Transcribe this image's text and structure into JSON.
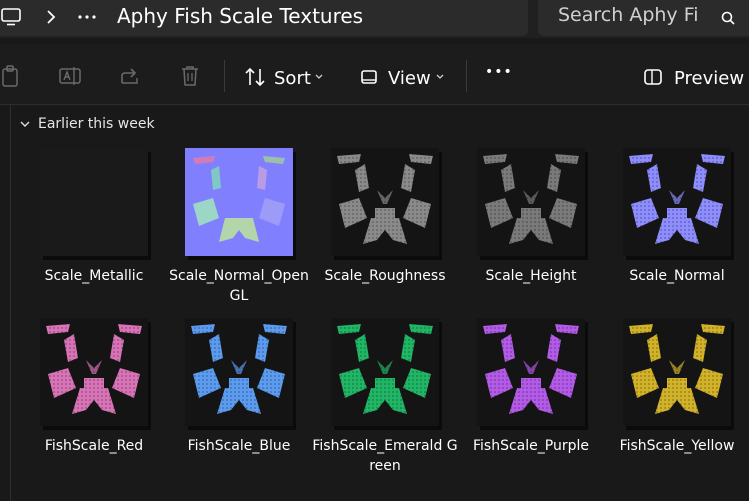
{
  "window": {
    "title": "Aphy Fish Scale Textures",
    "search_placeholder": "Search Aphy Fi"
  },
  "toolbar": {
    "sort_label": "Sort",
    "view_label": "View",
    "more_label": "•••",
    "preview_label": "Preview"
  },
  "group": {
    "label": "Earlier this week"
  },
  "files": [
    {
      "name": "Scale_Metallic",
      "color": "#1a1a1a",
      "style": "dark"
    },
    {
      "name": "Scale_Normal_OpenGL",
      "color": "#8080ff",
      "style": "normalgl"
    },
    {
      "name": "Scale_Roughness",
      "color": "#8a8a8a",
      "style": "mask"
    },
    {
      "name": "Scale_Height",
      "color": "#7a7a7a",
      "style": "mask"
    },
    {
      "name": "Scale_Normal",
      "color": "#8d8dff",
      "style": "mask"
    },
    {
      "name": "FishScale_Red",
      "color": "#d873b8",
      "style": "mask"
    },
    {
      "name": "FishScale_Blue",
      "color": "#5b9bf0",
      "style": "mask"
    },
    {
      "name": "FishScale_Emerald Green",
      "color": "#21b566",
      "style": "mask"
    },
    {
      "name": "FishScale_Purple",
      "color": "#b35be8",
      "style": "mask"
    },
    {
      "name": "FishScale_Yellow",
      "color": "#d2b229",
      "style": "mask"
    }
  ]
}
